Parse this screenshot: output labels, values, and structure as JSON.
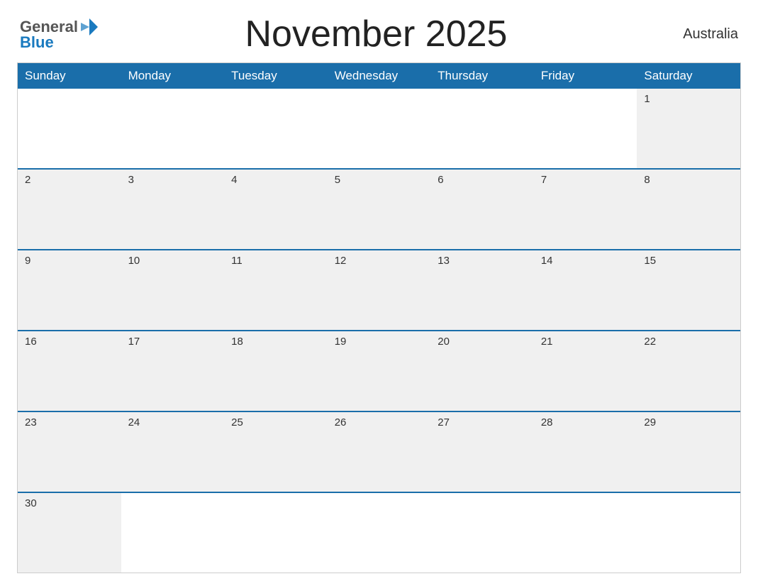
{
  "header": {
    "logo_general": "General",
    "logo_blue": "Blue",
    "title": "November 2025",
    "country": "Australia"
  },
  "calendar": {
    "day_headers": [
      "Sunday",
      "Monday",
      "Tuesday",
      "Wednesday",
      "Thursday",
      "Friday",
      "Saturday"
    ],
    "weeks": [
      [
        {
          "day": "",
          "empty": true
        },
        {
          "day": "",
          "empty": true
        },
        {
          "day": "",
          "empty": true
        },
        {
          "day": "",
          "empty": true
        },
        {
          "day": "",
          "empty": true
        },
        {
          "day": "",
          "empty": true
        },
        {
          "day": "1",
          "empty": false
        }
      ],
      [
        {
          "day": "2",
          "empty": false
        },
        {
          "day": "3",
          "empty": false
        },
        {
          "day": "4",
          "empty": false
        },
        {
          "day": "5",
          "empty": false
        },
        {
          "day": "6",
          "empty": false
        },
        {
          "day": "7",
          "empty": false
        },
        {
          "day": "8",
          "empty": false
        }
      ],
      [
        {
          "day": "9",
          "empty": false
        },
        {
          "day": "10",
          "empty": false
        },
        {
          "day": "11",
          "empty": false
        },
        {
          "day": "12",
          "empty": false
        },
        {
          "day": "13",
          "empty": false
        },
        {
          "day": "14",
          "empty": false
        },
        {
          "day": "15",
          "empty": false
        }
      ],
      [
        {
          "day": "16",
          "empty": false
        },
        {
          "day": "17",
          "empty": false
        },
        {
          "day": "18",
          "empty": false
        },
        {
          "day": "19",
          "empty": false
        },
        {
          "day": "20",
          "empty": false
        },
        {
          "day": "21",
          "empty": false
        },
        {
          "day": "22",
          "empty": false
        }
      ],
      [
        {
          "day": "23",
          "empty": false
        },
        {
          "day": "24",
          "empty": false
        },
        {
          "day": "25",
          "empty": false
        },
        {
          "day": "26",
          "empty": false
        },
        {
          "day": "27",
          "empty": false
        },
        {
          "day": "28",
          "empty": false
        },
        {
          "day": "29",
          "empty": false
        }
      ],
      [
        {
          "day": "30",
          "empty": false
        },
        {
          "day": "",
          "empty": true
        },
        {
          "day": "",
          "empty": true
        },
        {
          "day": "",
          "empty": true
        },
        {
          "day": "",
          "empty": true
        },
        {
          "day": "",
          "empty": true
        },
        {
          "day": "",
          "empty": true
        }
      ]
    ]
  }
}
